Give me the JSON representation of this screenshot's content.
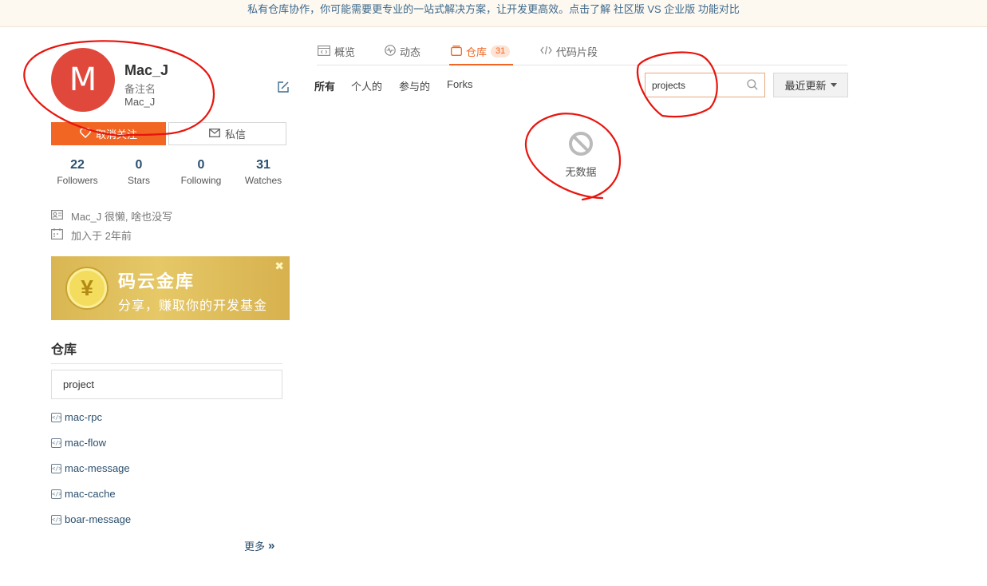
{
  "banner": {
    "text": "私有仓库协作，你可能需要更专业的一站式解决方案，让开发更高效。点击了解 社区版 VS 企业版 功能对比"
  },
  "profile": {
    "avatar_letter": "M",
    "avatar_color": "#e0483c",
    "name": "Mac_J",
    "remark": "备注名",
    "login": "Mac_J"
  },
  "actions": {
    "unfollow_label": "取消关注",
    "message_label": "私信"
  },
  "stats": [
    {
      "value": "22",
      "label": "Followers"
    },
    {
      "value": "0",
      "label": "Stars"
    },
    {
      "value": "0",
      "label": "Following"
    },
    {
      "value": "31",
      "label": "Watches"
    }
  ],
  "info": {
    "bio": "Mac_J 很懒, 啥也没写",
    "joined": "加入于 2年前"
  },
  "promo": {
    "coin_symbol": "¥",
    "title": "码云金库",
    "subtitle": "分享，赚取你的开发基金",
    "close_symbol": "✖"
  },
  "repos": {
    "title": "仓库",
    "filter_value": "project",
    "items": [
      "mac-rpc",
      "mac-flow",
      "mac-message",
      "mac-cache",
      "boar-message"
    ],
    "more_label": "更多"
  },
  "tabs": [
    {
      "label": "概览"
    },
    {
      "label": "动态"
    },
    {
      "label": "仓库",
      "badge": "31",
      "active": true
    },
    {
      "label": "代码片段"
    }
  ],
  "filters": [
    "所有",
    "个人的",
    "参与的",
    "Forks"
  ],
  "search": {
    "value": "projects"
  },
  "sort": {
    "label": "最近更新"
  },
  "empty": {
    "text": "无数据"
  },
  "colors": {
    "accent": "#f16622",
    "link": "#2a4f6e",
    "annotation": "#e8140e"
  }
}
